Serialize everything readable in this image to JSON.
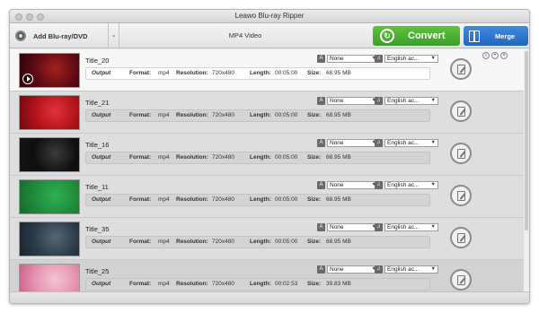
{
  "window": {
    "title": "Leawo Blu-ray Ripper"
  },
  "toolbar": {
    "add_label": "Add Blu-ray/DVD",
    "format_label": "MP4 Video",
    "convert_label": "Convert",
    "merge_label": "Merge"
  },
  "labels": {
    "output": "Output",
    "format": "Format:",
    "resolution": "Resolution:",
    "length": "Length:",
    "size": "Size:"
  },
  "titles": [
    {
      "name": "Title_20",
      "format": "mp4",
      "resolution": "720x480",
      "length": "00:05:00",
      "size": "68.95 MB",
      "subtitle": "None",
      "audio": "English ac...",
      "thumb_colors": [
        "#5a0a12",
        "#a3201f",
        "#2a0508"
      ],
      "selected": true
    },
    {
      "name": "Title_21",
      "format": "mp4",
      "resolution": "720x480",
      "length": "00:05:00",
      "size": "68.95 MB",
      "subtitle": "None",
      "audio": "English ac...",
      "thumb_colors": [
        "#b0121a",
        "#e2323a",
        "#6b0a10"
      ]
    },
    {
      "name": "Title_16",
      "format": "mp4",
      "resolution": "720x480",
      "length": "00:05:00",
      "size": "68.95 MB",
      "subtitle": "None",
      "audio": "English ac...",
      "thumb_colors": [
        "#0e0e0e",
        "#3b3b3b",
        "#141414"
      ]
    },
    {
      "name": "Title_11",
      "format": "mp4",
      "resolution": "720x480",
      "length": "00:05:00",
      "size": "68.95 MB",
      "subtitle": "None",
      "audio": "English ac...",
      "thumb_colors": [
        "#1f8a3a",
        "#2fb050",
        "#166b2c"
      ]
    },
    {
      "name": "Title_35",
      "format": "mp4",
      "resolution": "720x480",
      "length": "00:05:00",
      "size": "68.95 MB",
      "subtitle": "None",
      "audio": "English ac...",
      "thumb_colors": [
        "#2a3a48",
        "#556677",
        "#1b2530"
      ]
    },
    {
      "name": "Title_25",
      "format": "mp4",
      "resolution": "720x480",
      "length": "00:02:53",
      "size": "39.83 MB",
      "subtitle": "None",
      "audio": "English ac...",
      "thumb_colors": [
        "#e58fb0",
        "#f4c4d0",
        "#c75e85"
      ],
      "hover": true
    }
  ]
}
